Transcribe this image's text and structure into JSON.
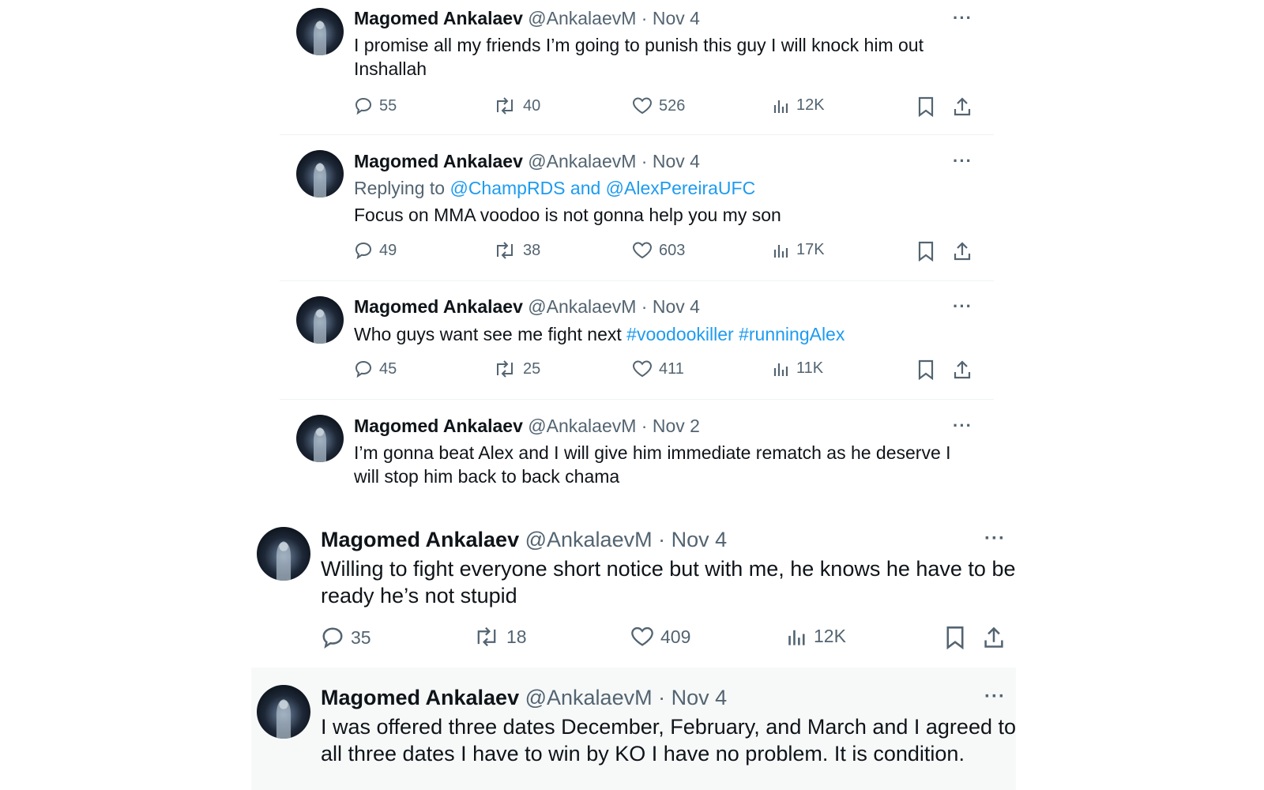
{
  "author": {
    "name": "Magomed Ankalaev",
    "handle": "@AnkalaevM",
    "separator": "·"
  },
  "more_label": "···",
  "tweets": [
    {
      "date": "Nov 4",
      "text": "I promise all my friends I’m going to punish this guy I will knock him out Inshallah",
      "stats": {
        "replies": "55",
        "retweets": "40",
        "likes": "526",
        "views": "12K"
      }
    },
    {
      "date": "Nov 4",
      "reply_prefix": "Replying to",
      "reply_to": "@ChampRDS and @AlexPereiraUFC",
      "text": "Focus on MMA voodoo is not gonna help you my son",
      "stats": {
        "replies": "49",
        "retweets": "38",
        "likes": "603",
        "views": "17K"
      }
    },
    {
      "date": "Nov 4",
      "text": "Who guys want see me fight next",
      "hashtags": "#voodookiller #runningAlex",
      "stats": {
        "replies": "45",
        "retweets": "25",
        "likes": "411",
        "views": "11K"
      }
    },
    {
      "date": "Nov 2",
      "text": "I’m gonna beat Alex and I will give him  immediate rematch as he deserve  I will stop him back to back chama"
    },
    {
      "date": "Nov 4",
      "text": "Willing to fight everyone  short notice but with me, he knows he have to be ready he’s not stupid",
      "stats": {
        "replies": "35",
        "retweets": "18",
        "likes": "409",
        "views": "12K"
      }
    },
    {
      "date": "Nov 4",
      "text": "I was offered three dates December, February, and March and I agreed to all three dates  I have to win by KO I have no problem. It is condition."
    }
  ]
}
